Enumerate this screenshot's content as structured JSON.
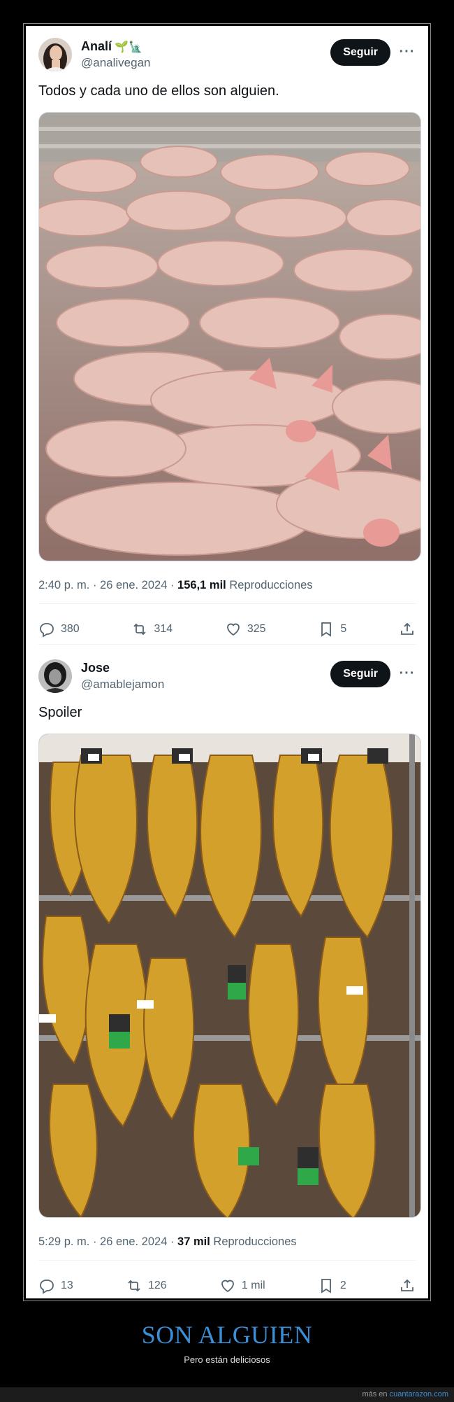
{
  "tweets": [
    {
      "display_name": "Analí",
      "emojis": "🌱🗽",
      "handle": "@analivegan",
      "follow_label": "Seguir",
      "more_label": "···",
      "text": "Todos y cada uno de ellos son alguien.",
      "time": "2:40 p. m. · 26 ene. 2024 · ",
      "views": "156,1 mil",
      "views_label": " Reproducciones",
      "replies": "380",
      "retweets": "314",
      "likes": "325",
      "bookmarks": "5",
      "media_description": "Photo of a crowded group of pink pigs"
    },
    {
      "display_name": "Jose",
      "emojis": "",
      "handle": "@amablejamon",
      "follow_label": "Seguir",
      "more_label": "···",
      "text": "Spoiler",
      "time": "5:29 p. m. · 26 ene. 2024 · ",
      "views": "37 mil",
      "views_label": " Reproducciones",
      "replies": "13",
      "retweets": "126",
      "likes": "1 mil",
      "bookmarks": "2",
      "media_description": "Photo of cured hams hanging on racks"
    }
  ],
  "caption": {
    "title": "SON ALGUIEN",
    "subtitle": "Pero están deliciosos"
  },
  "footer": {
    "prefix": "más en ",
    "link": "cuantarazon.com"
  },
  "colors": {
    "follow_bg": "#0f1419",
    "secondary_text": "#536471",
    "caption_blue": "#3b8fd6"
  }
}
